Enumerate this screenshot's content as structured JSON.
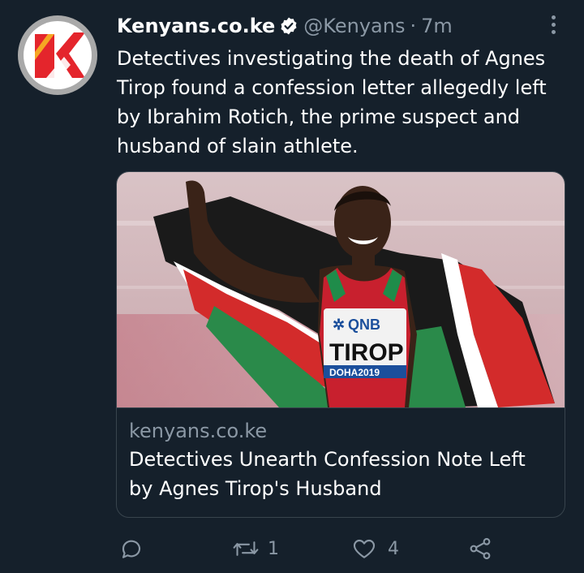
{
  "tweet": {
    "author_name": "Kenyans.co.ke",
    "handle": "@Kenyans",
    "separator": "·",
    "time": "7m",
    "text": "Detectives investigating the death of Agnes Tirop found a confession letter allegedly left by Ibrahim Rotich, the prime suspect and husband of slain athlete.",
    "avatar_icon": "kenyans-k-logo",
    "verified_icon": "verified-badge-icon",
    "more_icon": "more-options-icon"
  },
  "card": {
    "domain": "kenyans.co.ke",
    "title": "Detectives Unearth Confession Note Left by Agnes Tirop's Husband",
    "image": {
      "bib_sponsor": "QNB",
      "bib_name": "TIROP",
      "bib_event": "DOHA2019"
    }
  },
  "actions": {
    "reply_count": "",
    "retweet_count": "1",
    "like_count": "4",
    "share_count": ""
  },
  "colors": {
    "background": "#15202b",
    "text_primary": "#ffffff",
    "text_secondary": "#8b98a5",
    "border": "#38444d",
    "logo_red": "#e4252c",
    "logo_orange": "#f5a623"
  }
}
